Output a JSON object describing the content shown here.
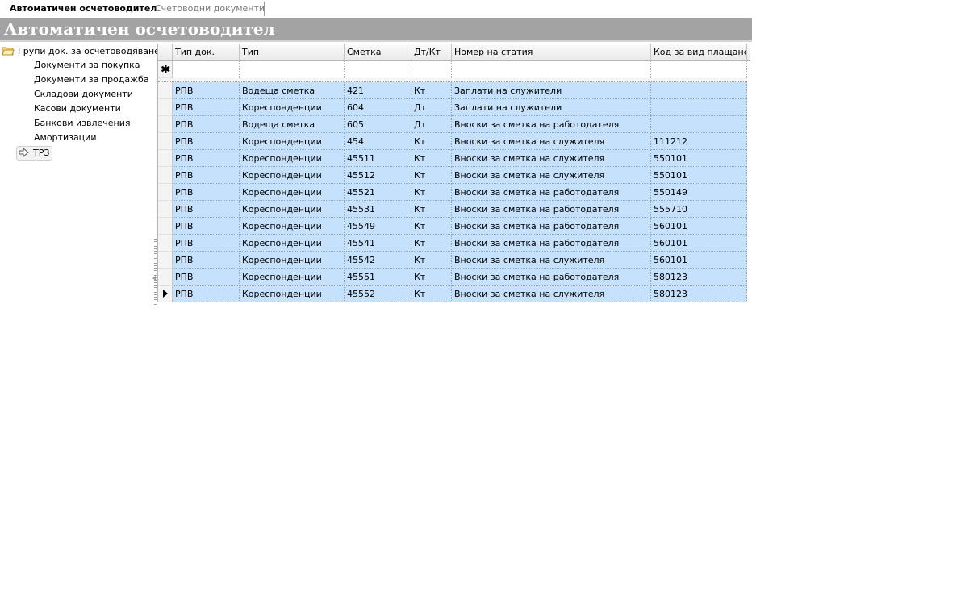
{
  "tabs": [
    {
      "label": "Автоматичен осчетоводител",
      "active": true
    },
    {
      "label": "Счетоводни документи",
      "active": false
    }
  ],
  "title": "Автоматичен осчетоводител",
  "tree": {
    "root": "Групи док. за осчетоводяване",
    "items": [
      "Документи за покупка",
      "Документи за продажба",
      "Складови документи",
      "Касови документи",
      "Банкови извлечения",
      "Амортизации",
      "ТРЗ"
    ],
    "selected_index": 6
  },
  "grid": {
    "columns": [
      "Тип док.",
      "Тип",
      "Сметка",
      "Дт/Кт",
      "Номер на статия",
      "Код за вид плащане"
    ],
    "rows": [
      [
        "РПВ",
        "Водеща сметка",
        "421",
        "Кт",
        "Заплати на служители",
        ""
      ],
      [
        "РПВ",
        "Кореспонденции",
        "604",
        "Дт",
        "Заплати на служители",
        ""
      ],
      [
        "РПВ",
        "Водеща сметка",
        "605",
        "Дт",
        "Вноски за сметка на работодателя",
        ""
      ],
      [
        "РПВ",
        "Кореспонденции",
        "454",
        "Кт",
        "Вноски за сметка на служителя",
        "111212"
      ],
      [
        "РПВ",
        "Кореспонденции",
        "45511",
        "Кт",
        "Вноски за сметка на служителя",
        "550101"
      ],
      [
        "РПВ",
        "Кореспонденции",
        "45512",
        "Кт",
        "Вноски за сметка на служителя",
        "550101"
      ],
      [
        "РПВ",
        "Кореспонденции",
        "45521",
        "Кт",
        "Вноски за сметка на работодателя",
        "550149"
      ],
      [
        "РПВ",
        "Кореспонденции",
        "45531",
        "Кт",
        "Вноски за сметка на работодателя",
        "555710"
      ],
      [
        "РПВ",
        "Кореспонденции",
        "45549",
        "Кт",
        "Вноски за сметка на работодателя",
        "560101"
      ],
      [
        "РПВ",
        "Кореспонденции",
        "45541",
        "Кт",
        "Вноски за сметка на работодателя",
        "560101"
      ],
      [
        "РПВ",
        "Кореспонденции",
        "45542",
        "Кт",
        "Вноски за сметка на служителя",
        "560101"
      ],
      [
        "РПВ",
        "Кореспонденции",
        "45551",
        "Кт",
        "Вноски за сметка на работодателя",
        "580123"
      ],
      [
        "РПВ",
        "Кореспонденции",
        "45552",
        "Кт",
        "Вноски за сметка на служителя",
        "580123"
      ]
    ],
    "current_row": 12,
    "new_row_icon": "asterisk-icon",
    "row_marker_icon": "current-row-arrow-icon"
  },
  "colors": {
    "title_bar": "#a3a3a3",
    "row_highlight": "#c6e1fb"
  }
}
